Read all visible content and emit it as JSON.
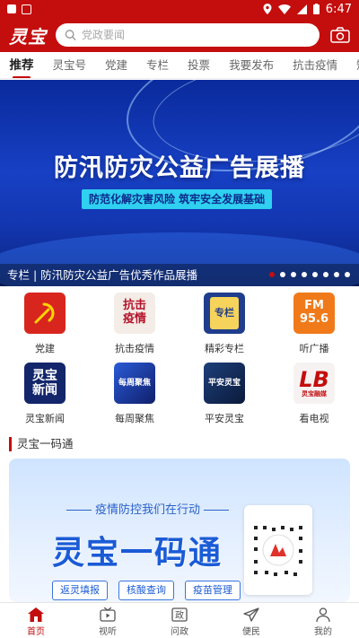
{
  "status_bar": {
    "time": "6:47"
  },
  "header": {
    "logo": "灵宝",
    "search_placeholder": "党政要闻"
  },
  "tabs": [
    "推荐",
    "灵宝号",
    "党建",
    "专栏",
    "投票",
    "我要发布",
    "抗击疫情",
    "短视"
  ],
  "banner": {
    "title": "防汛防灾公益广告展播",
    "subtitle": "防范化解灾害风险  筑牢安全发展基础",
    "caption": "专栏 | 防汛防灾公益广告优秀作品展播",
    "dot_count": 8,
    "active_dot": 0
  },
  "grid": [
    {
      "label": "党建",
      "icon": "party-emblem-icon",
      "color": "#d8261f"
    },
    {
      "label": "抗击疫情",
      "icon": "fight-epidemic-icon",
      "color": "#f4ece6",
      "text": "抗击\n疫情"
    },
    {
      "label": "精彩专栏",
      "icon": "column-clipboard-icon",
      "color": "#1f3d8c",
      "text": "专栏"
    },
    {
      "label": "听广播",
      "icon": "radio-fm-icon",
      "color": "#f07a1a",
      "text": "FM\n95.6"
    },
    {
      "label": "灵宝新闻",
      "icon": "news-icon",
      "color": "#13266b",
      "text": "灵宝\n新闻"
    },
    {
      "label": "每周聚焦",
      "icon": "weekly-focus-icon",
      "color": "#1a3ca8",
      "text": "每周聚焦"
    },
    {
      "label": "平安灵宝",
      "icon": "safe-lingbao-icon",
      "color": "#122a5a",
      "text": "平安灵宝"
    },
    {
      "label": "看电视",
      "icon": "tv-logo-icon",
      "color": "#f7f2f2",
      "text": "灵宝融媒"
    }
  ],
  "section": {
    "title": "灵宝一码通"
  },
  "promo": {
    "top_text": "疫情防控我们在行动",
    "big_text": "灵宝一码通",
    "buttons": [
      "返灵填报",
      "核酸查询",
      "疫苗管理"
    ]
  },
  "bottom_nav": [
    {
      "label": "首页",
      "icon": "home-icon",
      "active": true
    },
    {
      "label": "视听",
      "icon": "tv-icon",
      "active": false
    },
    {
      "label": "问政",
      "icon": "inquiry-icon",
      "active": false
    },
    {
      "label": "便民",
      "icon": "send-icon",
      "active": false
    },
    {
      "label": "我的",
      "icon": "user-icon",
      "active": false
    }
  ],
  "colors": {
    "brand": "#c40d0d",
    "promo_blue": "#1a5bd6"
  }
}
